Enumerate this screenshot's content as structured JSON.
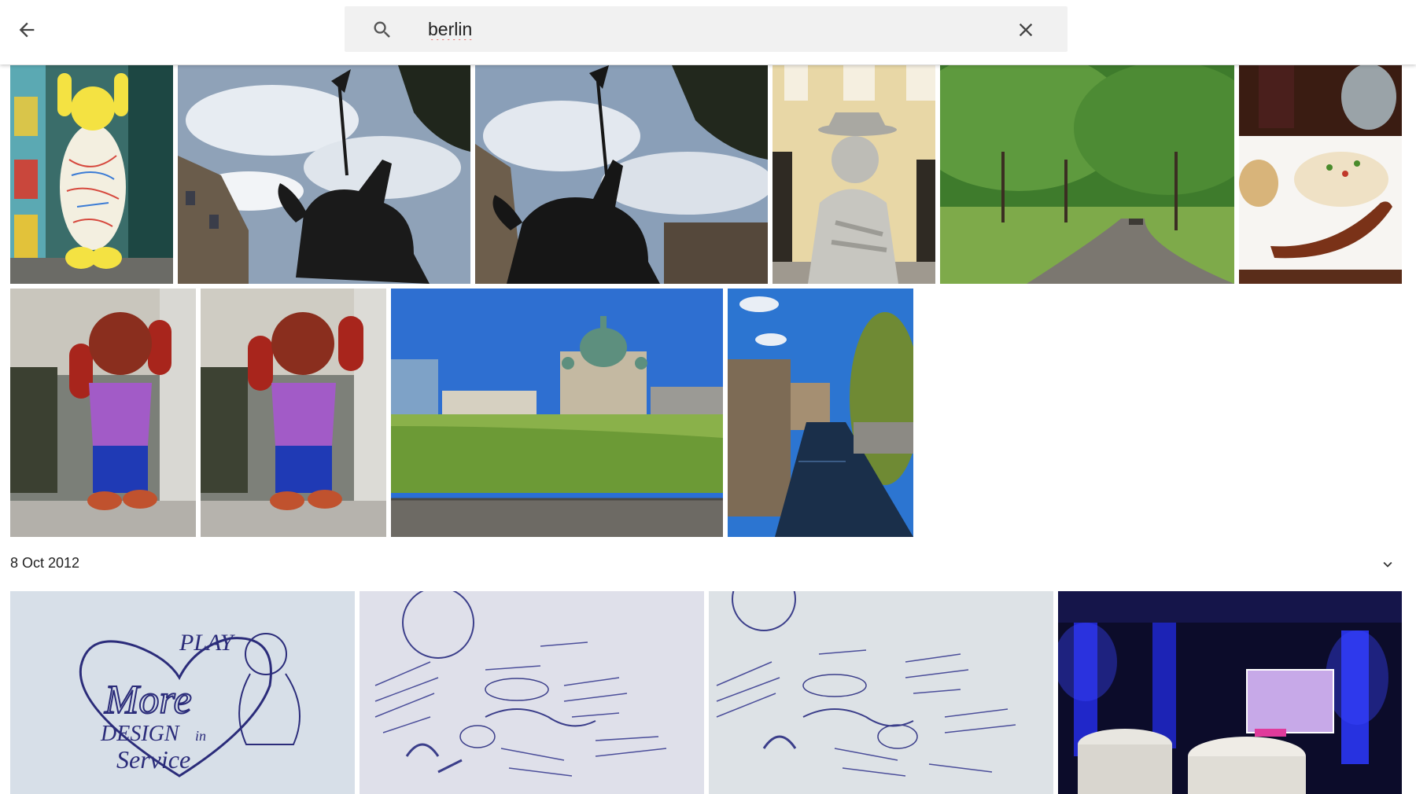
{
  "search": {
    "query": "berlin"
  },
  "icons": {
    "back": "arrow-back-icon",
    "search": "search-icon",
    "clear": "close-icon",
    "collapse": "chevron-down-icon"
  },
  "section": {
    "date": "8 Oct 2012"
  },
  "sketch": {
    "play": "PLAY",
    "more": "More",
    "design": "DESIGN",
    "in": "in",
    "service": "Service"
  }
}
